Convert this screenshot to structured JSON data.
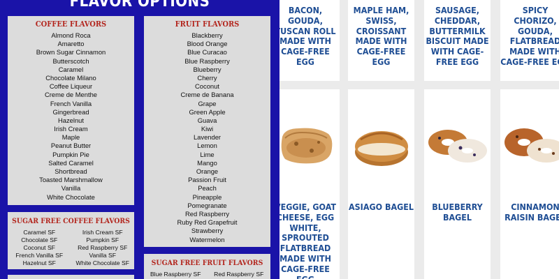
{
  "flavor_panel": {
    "title": "FLAVOR OPTIONS",
    "coffee": {
      "heading": "COFFEE FLAVORS",
      "items": [
        "Almond Roca",
        "Amaretto",
        "Brown Sugar Cinnamon",
        "Butterscotch",
        "Caramel",
        "Chocolate Milano",
        "Coffee Liqueur",
        "Creme de Menthe",
        "French Vanilla",
        "Gingerbread",
        "Hazelnut",
        "Irish Cream",
        "Maple",
        "Peanut Butter",
        "Pumpkin Pie",
        "Salted Caramel",
        "Shortbread",
        "Toasted Marshmallow",
        "Vanilla",
        "White Chocolate"
      ]
    },
    "fruit": {
      "heading": "FRUIT FLAVORS",
      "items": [
        "Blackberry",
        "Blood Orange",
        "Blue Curacao",
        "Blue Raspberry",
        "Blueberry",
        "Cherry",
        "Coconut",
        "Creme de Banana",
        "Grape",
        "Green Apple",
        "Guava",
        "Kiwi",
        "Lavender",
        "Lemon",
        "Lime",
        "Mango",
        "Orange",
        "Passion Fruit",
        "Peach",
        "Pineapple",
        "Pomegranate",
        "Red Raspberry",
        "Ruby Red Grapefruit",
        "Strawberry",
        "Watermelon"
      ]
    },
    "sugar_free_coffee": {
      "heading": "SUGAR FREE COFFEE FLAVORS",
      "items": [
        "Caramel SF",
        "Irish Cream SF",
        "Chocolate SF",
        "Pumpkin SF",
        "Coconut SF",
        "Red Raspberry SF",
        "French Vanilla SF",
        "Vanilla SF",
        "Hazelnut SF",
        "White Chocolate SF"
      ]
    },
    "sugar_free_fruit": {
      "heading": "SUGAR FREE FRUIT FLAVORS",
      "items": [
        "Blue Raspberry SF",
        "Red Raspberry SF"
      ]
    }
  },
  "products": {
    "row1": [
      {
        "name": "BACON, GOUDA, TUSCAN ROLL MADE WITH CAGE-FREE EGG"
      },
      {
        "name": "MAPLE HAM, SWISS, CROISSANT MADE WITH CAGE-FREE EGG"
      },
      {
        "name": "SAUSAGE, CHEDDAR, BUTTERMILK BISCUIT MADE WITH CAGE-FREE EGG"
      },
      {
        "name": "SPICY CHORIZO, GOUDA, FLATBREAD MADE WITH CAGE-FREE EGG"
      }
    ],
    "row2": [
      {
        "name": "VEGGIE, GOAT CHEESE, EGG WHITE, SPROUTED FLATBREAD MADE WITH CAGE-FREE EGG",
        "image_icon": "flatbread-sandwich-image"
      },
      {
        "name": "ASIAGO BAGEL",
        "image_icon": "asiago-bagel-image"
      },
      {
        "name": "BLUEBERRY BAGEL",
        "image_icon": "blueberry-bagel-image"
      },
      {
        "name": "CINNAMON RAISIN BAGEL",
        "image_icon": "cinnamon-raisin-bagel-image"
      }
    ]
  }
}
